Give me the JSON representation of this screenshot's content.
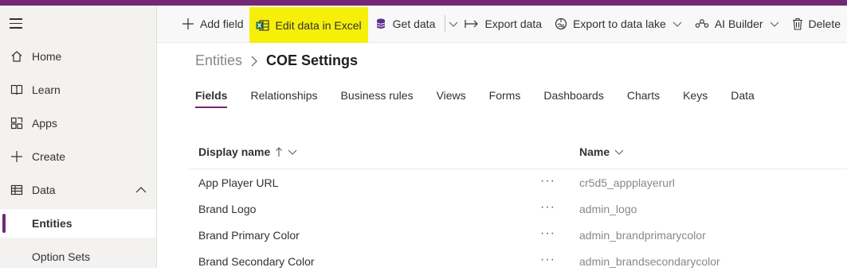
{
  "sidebar": {
    "items": [
      {
        "label": "Home",
        "icon": "home-icon"
      },
      {
        "label": "Learn",
        "icon": "book-icon"
      },
      {
        "label": "Apps",
        "icon": "apps-icon"
      },
      {
        "label": "Create",
        "icon": "plus-icon"
      },
      {
        "label": "Data",
        "icon": "table-icon",
        "expanded": true
      }
    ],
    "subitems": [
      {
        "label": "Entities",
        "active": true
      },
      {
        "label": "Option Sets",
        "active": false
      }
    ]
  },
  "toolbar": {
    "add_field": "Add field",
    "edit_excel": "Edit data in Excel",
    "get_data": "Get data",
    "export_data": "Export data",
    "export_lake": "Export to data lake",
    "ai_builder": "AI Builder",
    "delete": "Delete"
  },
  "breadcrumb": {
    "root": "Entities",
    "current": "COE Settings"
  },
  "tabs": [
    "Fields",
    "Relationships",
    "Business rules",
    "Views",
    "Forms",
    "Dashboards",
    "Charts",
    "Keys",
    "Data"
  ],
  "table": {
    "col_display": "Display name",
    "col_name": "Name",
    "rows": [
      {
        "display": "App Player URL",
        "more": "···",
        "name": "cr5d5_appplayerurl"
      },
      {
        "display": "Brand Logo",
        "more": "···",
        "name": "admin_logo"
      },
      {
        "display": "Brand Primary Color",
        "more": "···",
        "name": "admin_brandprimarycolor"
      },
      {
        "display": "Brand Secondary Color",
        "more": "···",
        "name": "admin_brandsecondarycolor"
      }
    ]
  },
  "colors": {
    "accent": "#742774",
    "highlight": "#f5ef0a",
    "excel_green": "#217346"
  }
}
